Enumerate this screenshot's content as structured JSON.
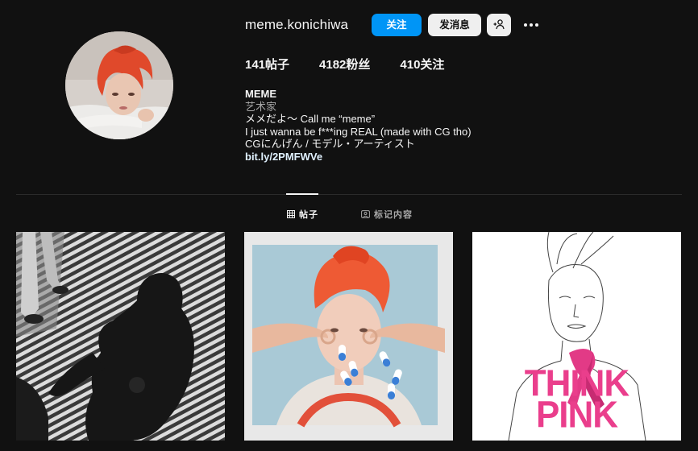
{
  "profile": {
    "username": "meme.konichiwa",
    "follow_label": "关注",
    "message_label": "发消息",
    "suggest_icon": "person-plus-icon",
    "more_icon": "more-horizontal-icon"
  },
  "stats": {
    "posts": "141帖子",
    "followers": "4182粉丝",
    "following": "410关注"
  },
  "bio": {
    "name": "MEME",
    "category": "艺术家",
    "line1": "メメだよ～ Call me “meme”",
    "line2": "I just wanna be f***ing REAL (made with CG tho)",
    "line3": "CGにんげん / モデル・アーティスト",
    "link": "bit.ly/2PMFWVe"
  },
  "tabs": {
    "posts_label": "帖子",
    "tagged_label": "标记内容",
    "posts_icon": "grid-icon",
    "tagged_icon": "tag-portrait-icon"
  },
  "posts": [
    {
      "description": "black-and-white shadow photo"
    },
    {
      "description": "red-haired woman with pills"
    },
    {
      "description": "line drawing with text"
    }
  ],
  "post3_text": {
    "line1": "THINK",
    "line2": "PINK"
  },
  "colors": {
    "background": "#111111",
    "accent_blue": "#0095f6",
    "pink": "#ea3e8c"
  }
}
